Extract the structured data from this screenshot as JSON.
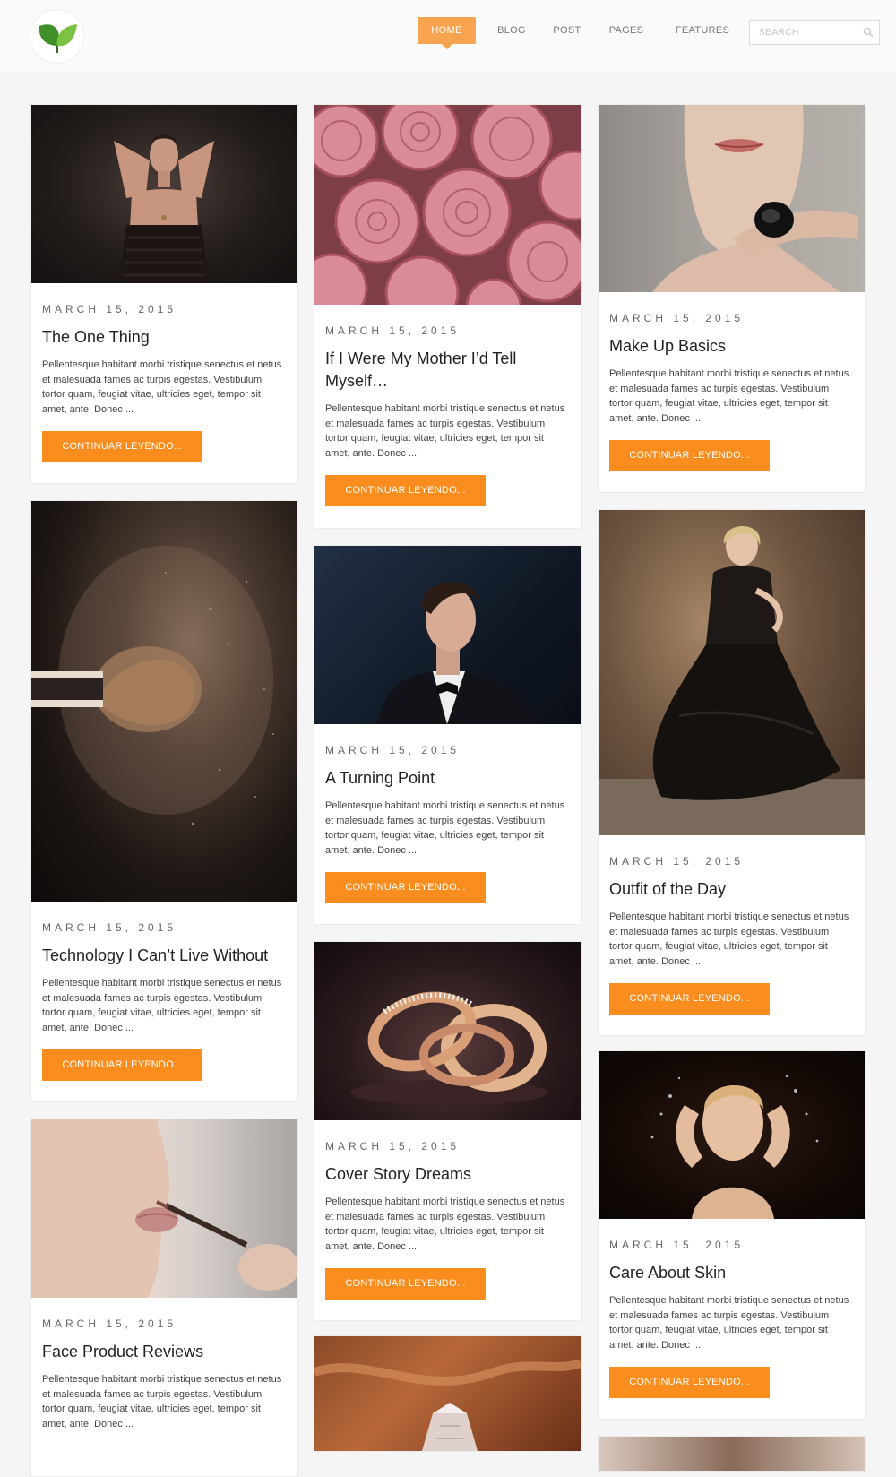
{
  "nav": {
    "items": [
      {
        "label": "HOME",
        "active": true
      },
      {
        "label": "BLOG",
        "active": false
      },
      {
        "label": "POST",
        "active": false
      },
      {
        "label": "PAGES",
        "active": false
      },
      {
        "label": "FEATURES",
        "active": false
      }
    ],
    "search_placeholder": "SEARCH"
  },
  "colors": {
    "accent": "#fb8c1e",
    "nav_active": "#f7a34f",
    "logo_leaf_dark": "#3f8f2a",
    "logo_leaf_light": "#7cc242"
  },
  "posts": [
    {
      "date": "MARCH 15, 2015",
      "title": "The One Thing",
      "excerpt": "Pellentesque habitant morbi tristique senectus et netus et malesuada fames ac turpis egestas. Vestibulum tortor quam, feugiat vitae, ultricies eget, tempor sit amet, ante. Donec ...",
      "button": "CONTINUAR LEYENDO...",
      "image": "woman in black strapless dress"
    },
    {
      "date": "MARCH 15, 2015",
      "title": "If I Were My Mother I’d Tell Myself…",
      "excerpt": "Pellentesque habitant morbi tristique senectus et netus et malesuada fames ac turpis egestas. Vestibulum tortor quam, feugiat vitae, ultricies eget, tempor sit amet, ante. Donec ...",
      "button": "CONTINUAR LEYENDO...",
      "image": "pink roses"
    },
    {
      "date": "MARCH 15, 2015",
      "title": "Make Up Basics",
      "excerpt": "Pellentesque habitant morbi tristique senectus et netus et malesuada fames ac turpis egestas. Vestibulum tortor quam, feugiat vitae, ultricies eget, tempor sit amet, ante. Donec ...",
      "button": "CONTINUAR LEYENDO...",
      "image": "woman with black ring"
    },
    {
      "date": "MARCH 15, 2015",
      "title": "Technology I Can’t Live Without",
      "excerpt": "Pellentesque habitant morbi tristique senectus et netus et malesuada fames ac turpis egestas. Vestibulum tortor quam, feugiat vitae, ultricies eget, tempor sit amet, ante. Donec ...",
      "button": "CONTINUAR LEYENDO...",
      "image": "makeup brush with powder"
    },
    {
      "date": "MARCH 15, 2015",
      "title": "A Turning Point",
      "excerpt": "Pellentesque habitant morbi tristique senectus et netus et malesuada fames ac turpis egestas. Vestibulum tortor quam, feugiat vitae, ultricies eget, tempor sit amet, ante. Donec ...",
      "button": "CONTINUAR LEYENDO...",
      "image": "man in tuxedo"
    },
    {
      "date": "MARCH 15, 2015",
      "title": "Outfit of the Day",
      "excerpt": "Pellentesque habitant morbi tristique senectus et netus et malesuada fames ac turpis egestas. Vestibulum tortor quam, feugiat vitae, ultricies eget, tempor sit amet, ante. Donec ...",
      "button": "CONTINUAR LEYENDO...",
      "image": "woman in black gown"
    },
    {
      "date": "MARCH 15, 2015",
      "title": "Face Product Reviews",
      "excerpt": "Pellentesque habitant morbi tristique senectus et netus et malesuada fames ac turpis egestas. Vestibulum tortor quam, feugiat vitae, ultricies eget, tempor sit amet, ante. Donec ...",
      "button": "CONTINUAR LEYENDO...",
      "image": "lip pencil applied to lips"
    },
    {
      "date": "MARCH 15, 2015",
      "title": "Cover Story Dreams",
      "excerpt": "Pellentesque habitant morbi tristique senectus et netus et malesuada fames ac turpis egestas. Vestibulum tortor quam, feugiat vitae, ultricies eget, tempor sit amet, ante. Donec ...",
      "button": "CONTINUAR LEYENDO...",
      "image": "gold rings"
    },
    {
      "date": "MARCH 15, 2015",
      "title": "Care About Skin",
      "excerpt": "Pellentesque habitant morbi tristique senectus et netus et malesuada fames ac turpis egestas. Vestibulum tortor quam, feugiat vitae, ultricies eget, tempor sit amet, ante. Donec ...",
      "button": "CONTINUAR LEYENDO...",
      "image": "woman with water splash"
    }
  ]
}
